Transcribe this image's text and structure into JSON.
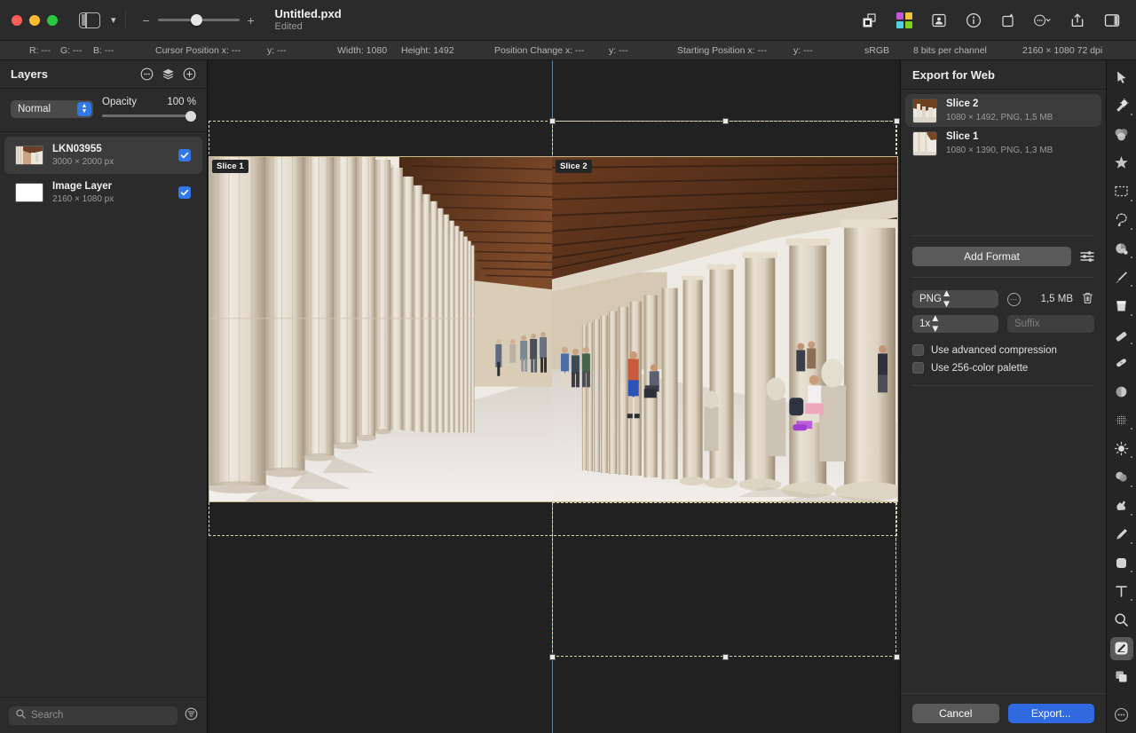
{
  "window": {
    "traffic_lights": [
      "close",
      "minimize",
      "zoom"
    ],
    "document_title": "Untitled.pxd",
    "document_state": "Edited",
    "zoom_minus": "−",
    "zoom_plus": "+",
    "zoom_value_percent": 41,
    "toolbar_icons": [
      "layer-duplicate-icon",
      "color-swatches-icon",
      "account-icon",
      "info-icon",
      "add-artboard-icon",
      "more-options-icon",
      "share-icon",
      "toggle-right-panel-icon"
    ],
    "swatch_colors": [
      "#c455d6",
      "#f2c43a",
      "#4fd0e3",
      "#7ed321"
    ]
  },
  "infobar": {
    "r": "R: ---",
    "g": "G: ---",
    "b": "B: ---",
    "cursor_position_x": "Cursor Position x: ---",
    "cursor_position_y": "y: ---",
    "width": "Width: 1080",
    "height": "Height: 1492",
    "position_change_x": "Position Change x: ---",
    "position_change_y": "y: ---",
    "starting_position_x": "Starting Position x: ---",
    "starting_position_y": "y: ---",
    "color_profile": "sRGB",
    "bit_depth": "8 bits per channel",
    "doc_size": "2160 × 1080 72 dpi"
  },
  "layers_panel": {
    "title": "Layers",
    "header_icons": [
      "more-options-icon",
      "layer-stack-icon",
      "add-layer-icon"
    ],
    "blend_mode": "Normal",
    "opacity_label": "Opacity",
    "opacity_value": "100 %",
    "opacity_percent": 100,
    "items": [
      {
        "name": "LKN03955",
        "size": "3000 × 2000 px",
        "visible": true,
        "selected": true,
        "thumb": "photo"
      },
      {
        "name": "Image Layer",
        "size": "2160 × 1080 px",
        "visible": true,
        "selected": false,
        "thumb": "white"
      }
    ],
    "search_placeholder": "Search",
    "filter_icon": "filter-icon"
  },
  "canvas": {
    "slice_labels": [
      "Slice 1",
      "Slice 2"
    ],
    "guide_color": "#61839e",
    "slice_border_color": "#d9d2b4"
  },
  "export_panel": {
    "title": "Export for Web",
    "slices": [
      {
        "name": "Slice 2",
        "details": "1080 × 1492, PNG, 1,5 MB",
        "selected": true
      },
      {
        "name": "Slice 1",
        "details": "1080 × 1390, PNG, 1,3 MB",
        "selected": false
      }
    ],
    "add_format_label": "Add Format",
    "settings_icon": "sliders-icon",
    "format": "PNG",
    "format_options_icon": "more-options-icon",
    "format_size": "1,5 MB",
    "delete_icon": "trash-icon",
    "scale": "1x",
    "suffix_placeholder": "Suffix",
    "checkboxes": [
      {
        "label": "Use advanced compression",
        "checked": false
      },
      {
        "label": "Use 256-color palette",
        "checked": false
      }
    ],
    "cancel_label": "Cancel",
    "export_label": "Export...",
    "export_button_color": "#3169e0"
  },
  "tools": [
    {
      "name": "arrow-select-tool",
      "active": false
    },
    {
      "name": "magic-wand-tool",
      "active": false
    },
    {
      "name": "color-adjust-tool",
      "active": false
    },
    {
      "name": "effects-star-tool",
      "active": false
    },
    {
      "name": "rectangle-select-tool",
      "active": false
    },
    {
      "name": "lasso-select-tool",
      "active": false
    },
    {
      "name": "paint-bucket-tool",
      "active": false
    },
    {
      "name": "brush-tool",
      "active": false
    },
    {
      "name": "fill-bucket-tool",
      "active": false
    },
    {
      "name": "eraser-tool",
      "active": false
    },
    {
      "name": "healing-brush-tool",
      "active": false
    },
    {
      "name": "blur-tool",
      "active": false
    },
    {
      "name": "noise-tool",
      "active": false
    },
    {
      "name": "dodge-tool",
      "active": false
    },
    {
      "name": "sponge-tool",
      "active": false
    },
    {
      "name": "smudge-hand-tool",
      "active": false
    },
    {
      "name": "pen-tool",
      "active": false
    },
    {
      "name": "shape-tool",
      "active": false
    },
    {
      "name": "text-tool",
      "active": false
    },
    {
      "name": "zoom-tool",
      "active": false
    },
    {
      "name": "slice-tool",
      "active": true
    },
    {
      "name": "crop-tool",
      "active": false
    },
    {
      "name": "more-tools-icon",
      "active": false
    }
  ]
}
